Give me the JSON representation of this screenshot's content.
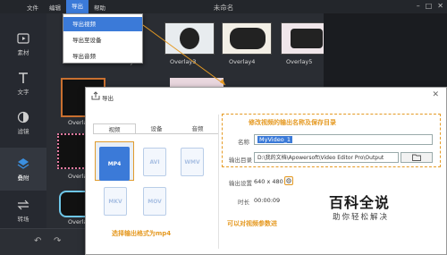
{
  "menubar": {
    "items": [
      "文件",
      "编辑",
      "导出",
      "帮助"
    ],
    "title": "未命名"
  },
  "export_menu": {
    "items": [
      "导出视频",
      "导出至设备",
      "导出音频"
    ]
  },
  "sidebar": {
    "items": [
      {
        "label": "素材",
        "icon": "media-icon"
      },
      {
        "label": "文字",
        "icon": "text-icon"
      },
      {
        "label": "滤镜",
        "icon": "filter-icon"
      },
      {
        "label": "叠附",
        "icon": "overlay-icon"
      },
      {
        "label": "转场",
        "icon": "transition-icon"
      }
    ]
  },
  "thumbnails": {
    "row1": [
      "Overlay2",
      "Overlay3",
      "Overlay4",
      "Overlay5"
    ],
    "partial_labels": [
      "Overla",
      "Overla",
      "Overla"
    ]
  },
  "dialog": {
    "title": "导出",
    "tabs": [
      "视频",
      "设备",
      "音频"
    ],
    "formats": [
      "MP4",
      "AVI",
      "WMV",
      "MKV",
      "MOV"
    ],
    "name_label": "名称",
    "name_value": "MyVideo_1",
    "output_label": "输出目录",
    "output_value": "D:\\我的文档\\Apowersoft\\Video Editor Pro\\Output",
    "settings_label": "输出设置",
    "settings_value": "640 x 480",
    "duration_label": "时长",
    "duration_value": "00:00:09"
  },
  "annotations": {
    "top": "修改视频的输出名称及保存目录",
    "format": "选择输出格式为mp4",
    "settings": "可以对视频参数进"
  },
  "watermark": {
    "title": "百科全说",
    "subtitle": "助你轻松解决"
  },
  "colors": {
    "accent": "#3b7ad8",
    "annotation": "#e59a23",
    "app_bg": "#2a2d33"
  }
}
